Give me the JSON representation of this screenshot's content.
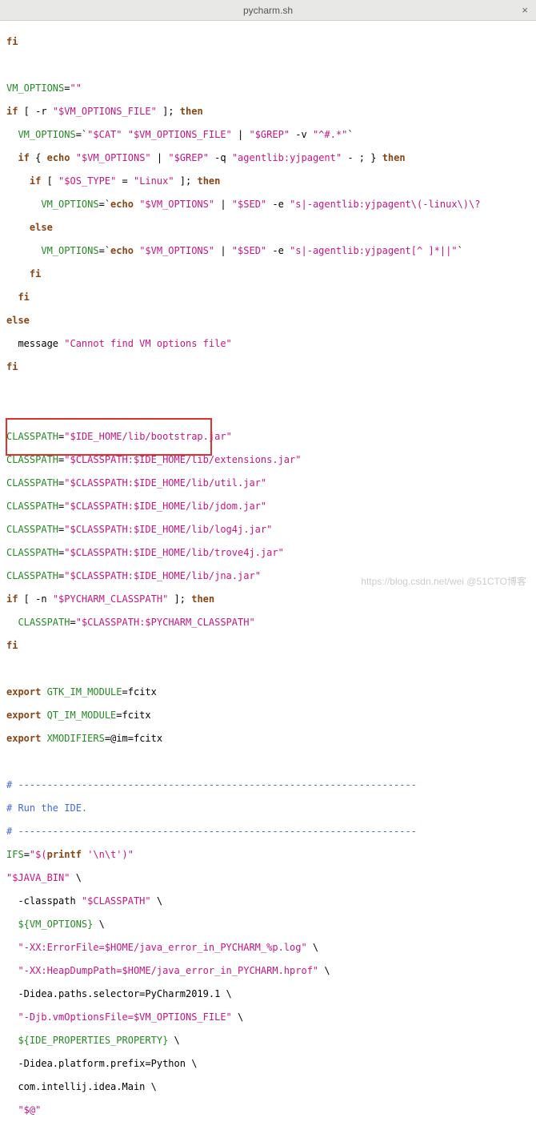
{
  "titlebar": {
    "title": "pycharm.sh",
    "close": "×"
  },
  "code": {
    "l01_fi": "fi",
    "l02_empty": "",
    "l03a": "VM_OPTIONS",
    "l03b": "=",
    "l03c": "\"\"",
    "l04a": "if",
    "l04b": " [ -r ",
    "l04c": "\"$VM_OPTIONS_FILE\"",
    "l04d": " ]; ",
    "l04e": "then",
    "l05a": "  VM_OPTIONS",
    "l05b": "=`",
    "l05c": "\"$CAT\" \"$VM_OPTIONS_FILE\"",
    "l05d": " | ",
    "l05e": "\"$GREP\"",
    "l05f": " -v ",
    "l05g": "\"^#.*\"",
    "l05h": "`",
    "l06a": "  ",
    "l06b": "if",
    "l06c": " { ",
    "l06d": "echo",
    "l06e": " ",
    "l06f": "\"$VM_OPTIONS\"",
    "l06g": " | ",
    "l06h": "\"$GREP\"",
    "l06i": " -q ",
    "l06j": "\"agentlib:yjpagent\"",
    "l06k": " - ; } ",
    "l06l": "then",
    "l07a": "    ",
    "l07b": "if",
    "l07c": " [ ",
    "l07d": "\"$OS_TYPE\"",
    "l07e": " = ",
    "l07f": "\"Linux\"",
    "l07g": " ]; ",
    "l07h": "then",
    "l08a": "      VM_OPTIONS",
    "l08b": "=`",
    "l08c": "echo",
    "l08d": " ",
    "l08e": "\"$VM_OPTIONS\"",
    "l08f": " | ",
    "l08g": "\"$SED\"",
    "l08h": " -e ",
    "l08i": "\"s|-agentlib:yjpagent\\(-linux\\)\\?",
    "l08j": "",
    "l09a": "    ",
    "l09b": "else",
    "l10a": "      VM_OPTIONS",
    "l10b": "=`",
    "l10c": "echo",
    "l10d": " ",
    "l10e": "\"$VM_OPTIONS\"",
    "l10f": " | ",
    "l10g": "\"$SED\"",
    "l10h": " -e ",
    "l10i": "\"s|-agentlib:yjpagent[^ ]*||\"",
    "l10j": "`",
    "l11a": "    ",
    "l11b": "fi",
    "l12a": "  ",
    "l12b": "fi",
    "l13a": "else",
    "l14a": "  message ",
    "l14b": "\"Cannot find VM options file\"",
    "l15a": "fi",
    "l16_empty": "",
    "l17_empty": "",
    "l18a": "CLASSPATH",
    "l18b": "=",
    "l18c": "\"$IDE_HOME",
    "l18d": "/lib/bootstrap.jar",
    "l18e": "\"",
    "l19a": "CLASSPATH",
    "l19b": "=",
    "l19c": "\"$CLASSPATH:$IDE_HOME",
    "l19d": "/lib/extensions.jar",
    "l19e": "\"",
    "l20a": "CLASSPATH",
    "l20b": "=",
    "l20c": "\"$CLASSPATH:$IDE_HOME",
    "l20d": "/lib/util.jar",
    "l20e": "\"",
    "l21a": "CLASSPATH",
    "l21b": "=",
    "l21c": "\"$CLASSPATH:$IDE_HOME",
    "l21d": "/lib/jdom.jar",
    "l21e": "\"",
    "l22a": "CLASSPATH",
    "l22b": "=",
    "l22c": "\"$CLASSPATH:$IDE_HOME",
    "l22d": "/lib/log4j.jar",
    "l22e": "\"",
    "l23a": "CLASSPATH",
    "l23b": "=",
    "l23c": "\"$CLASSPATH:$IDE_HOME",
    "l23d": "/lib/trove4j.jar",
    "l23e": "\"",
    "l24a": "CLASSPATH",
    "l24b": "=",
    "l24c": "\"$CLASSPATH:$IDE_HOME",
    "l24d": "/lib/jna.jar",
    "l24e": "\"",
    "l25a": "if",
    "l25b": " [ -n ",
    "l25c": "\"$PYCHARM_CLASSPATH\"",
    "l25d": " ]; ",
    "l25e": "then",
    "l26a": "  CLASSPATH",
    "l26b": "=",
    "l26c": "\"$CLASSPATH:$PYCHARM_CLASSPATH\"",
    "l27a": "fi",
    "l28_empty": "",
    "l29a": "export",
    "l29b": " GTK_IM_MODULE",
    "l29c": "=fcitx",
    "l30a": "export",
    "l30b": " QT_IM_MODULE",
    "l30c": "=fcitx",
    "l31a": "export",
    "l31b": " XMODIFIERS",
    "l31c": "=@im=fcitx",
    "l32_empty": "",
    "l33a": "# ---------------------------------------------------------------------",
    "l34a": "# Run the IDE.",
    "l35a": "# ---------------------------------------------------------------------",
    "l36a": "IFS",
    "l36b": "=",
    "l36c": "\"$(",
    "l36d": "printf ",
    "l36e": "'\\n\\t'",
    "l36f": ")\"",
    "l37a": "\"$JAVA_BIN\"",
    "l37b": " \\",
    "l38a": "  -classpath ",
    "l38b": "\"$CLASSPATH\"",
    "l38c": " \\",
    "l39a": "  ${VM_OPTIONS}",
    "l39b": " \\",
    "l40a": "  ",
    "l40b": "\"-XX:ErrorFile=$HOME",
    "l40c": "/java_error_in_PYCHARM_%p.log",
    "l40d": "\"",
    "l40e": " \\",
    "l41a": "  ",
    "l41b": "\"-XX:HeapDumpPath=$HOME",
    "l41c": "/java_error_in_PYCHARM.hprof",
    "l41d": "\"",
    "l41e": " \\",
    "l42a": "  -Didea.paths.selector",
    "l42b": "=PyCharm2019.1 \\",
    "l43a": "  ",
    "l43b": "\"-Djb.vmOptionsFile=$VM_OPTIONS_FILE\"",
    "l43c": " \\",
    "l44a": "  ${IDE_PROPERTIES_PROPERTY}",
    "l44b": " \\",
    "l45a": "  -Didea.platform.prefix",
    "l45b": "=Python \\",
    "l46a": "  com.intellij.idea.Main \\",
    "l47a": "  ",
    "l47b": "\"$@\""
  },
  "watermark": "https://blog.csdn.net/wei @51CTO博客"
}
